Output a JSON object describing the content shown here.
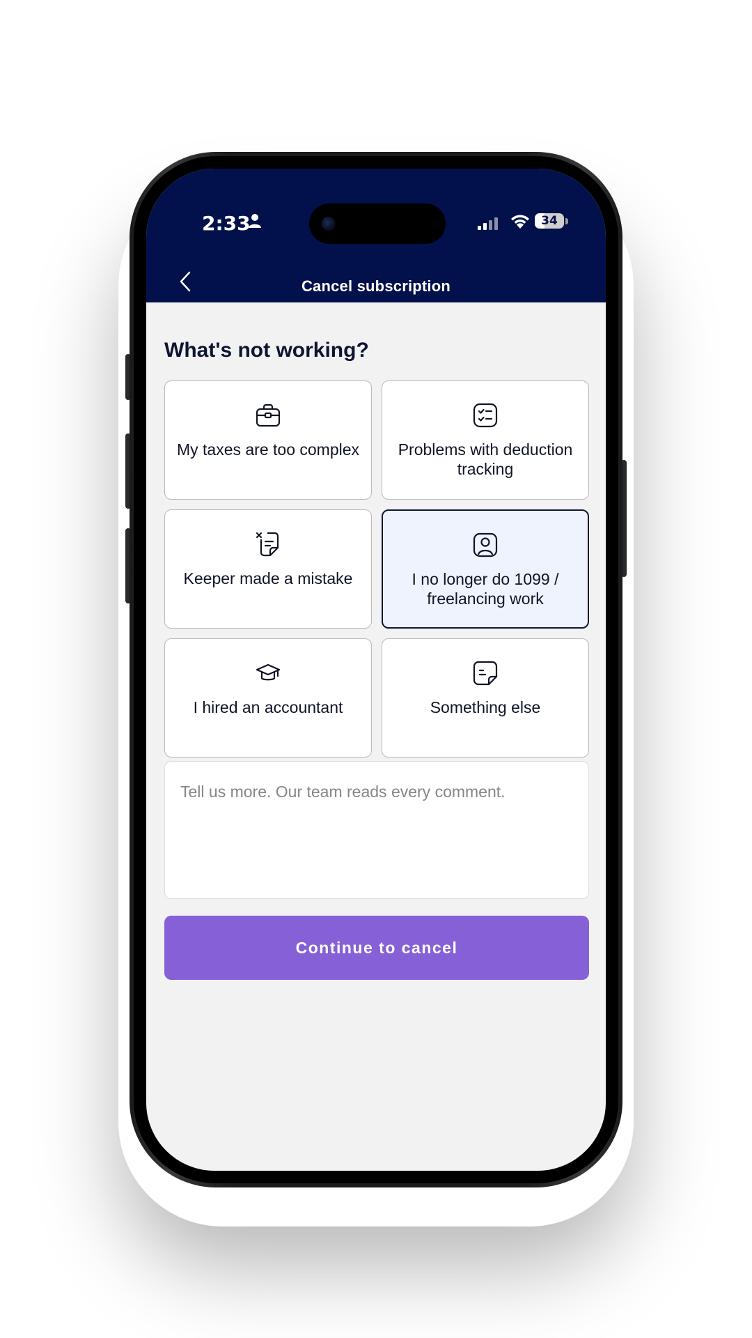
{
  "status_bar": {
    "time": "2:33",
    "battery": "34"
  },
  "header": {
    "title": "Cancel subscription"
  },
  "question": "What's not working?",
  "options": [
    {
      "label": "My taxes are too complex",
      "icon": "briefcase-icon",
      "selected": false
    },
    {
      "label": "Problems with deduction tracking",
      "icon": "checklist-icon",
      "selected": false
    },
    {
      "label": "Keeper made a mistake",
      "icon": "error-note-icon",
      "selected": false
    },
    {
      "label": "I no longer do 1099 / freelancing work",
      "icon": "user-badge-icon",
      "selected": true
    },
    {
      "label": "I hired an accountant",
      "icon": "graduation-cap-icon",
      "selected": false
    },
    {
      "label": "Something else",
      "icon": "document-icon",
      "selected": false
    }
  ],
  "comment": {
    "placeholder": "Tell us more. Our team reads every comment.",
    "value": ""
  },
  "cta": {
    "label": "Continue to cancel"
  },
  "colors": {
    "header_bg": "#02114b",
    "accent": "#8660d6",
    "selected_card_bg": "#eef3fd",
    "selected_card_border": "#0e1638"
  }
}
